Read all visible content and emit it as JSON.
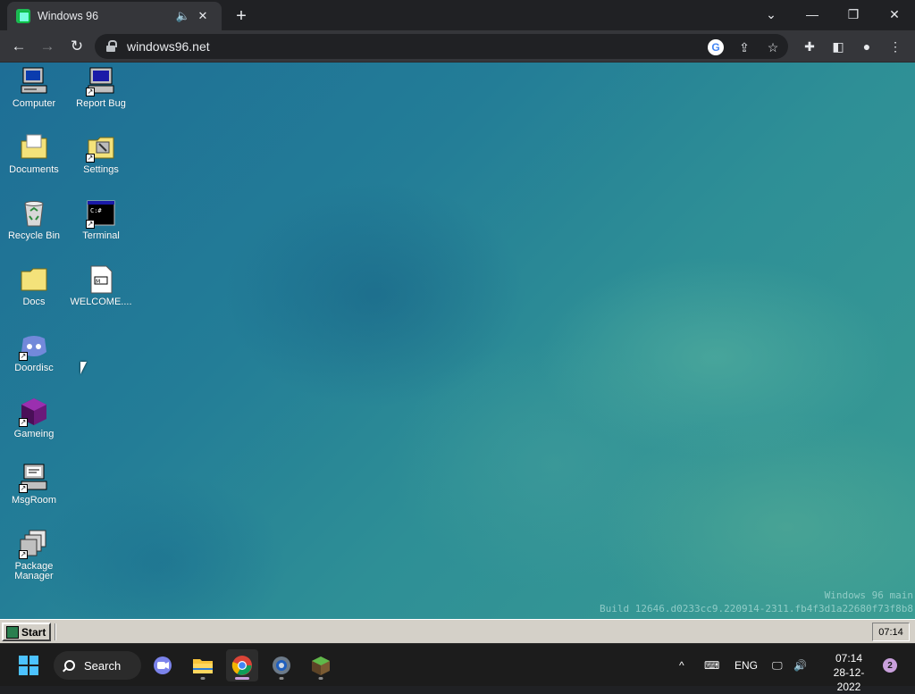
{
  "browser": {
    "tab_title": "Windows 96",
    "url": "windows96.net",
    "tab_icons": {
      "audio": "speaker-icon",
      "close": "close-icon"
    },
    "new_tab": "+"
  },
  "desktop": {
    "icons": [
      {
        "label": "Computer",
        "icon": "computer-icon"
      },
      {
        "label": "Report Bug",
        "icon": "report-bug-icon"
      },
      {
        "label": "Documents",
        "icon": "documents-folder-icon"
      },
      {
        "label": "Settings",
        "icon": "settings-folder-icon"
      },
      {
        "label": "Recycle Bin",
        "icon": "recycle-bin-icon"
      },
      {
        "label": "Terminal",
        "icon": "terminal-icon"
      },
      {
        "label": "Docs",
        "icon": "folder-icon"
      },
      {
        "label": "WELCOME....",
        "icon": "markdown-file-icon"
      },
      {
        "label": "Doordisc",
        "icon": "discord-icon"
      },
      {
        "label": "Gameing",
        "icon": "game-cube-icon"
      },
      {
        "label": "MsgRoom",
        "icon": "msgroom-icon"
      },
      {
        "label": "Package Manager",
        "icon": "package-manager-icon"
      }
    ],
    "build_line1": "Windows 96 main",
    "build_line2": "Build 12646.d0233cc9.220914-2311.fb4f3d1a22680f73f8b8"
  },
  "w96_taskbar": {
    "start_label": "Start",
    "clock": "07:14"
  },
  "os_taskbar": {
    "search_label": "Search",
    "language": "ENG",
    "time": "07:14",
    "date": "28-12-2022",
    "notification_count": "2"
  }
}
